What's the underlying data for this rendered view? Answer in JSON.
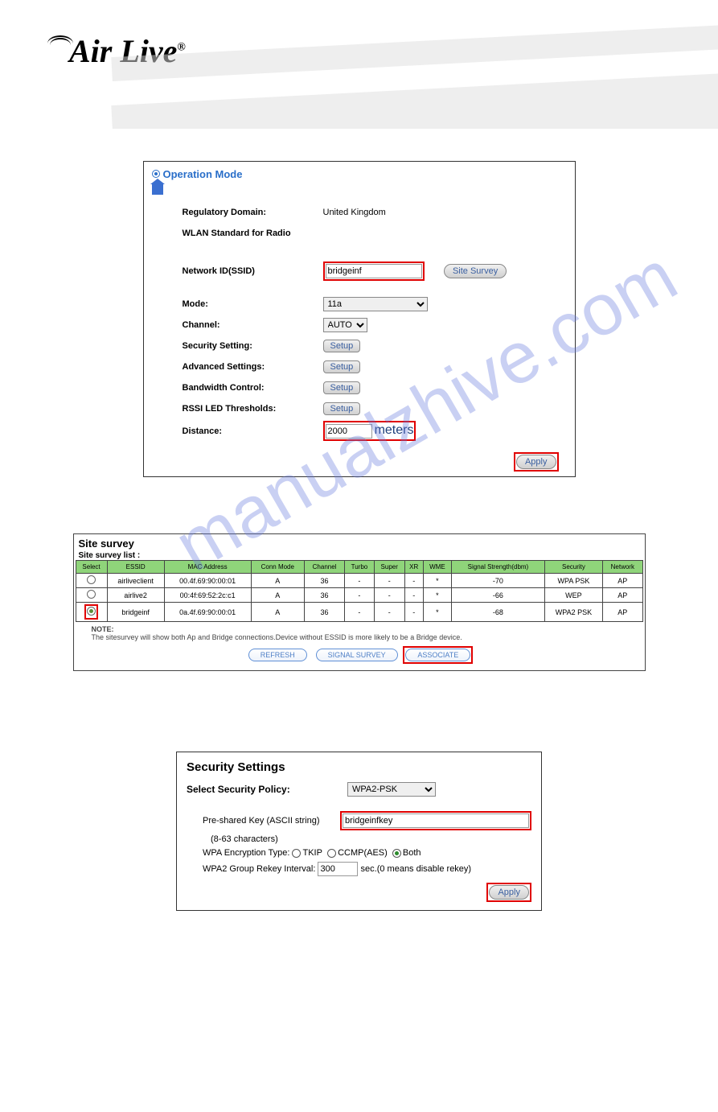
{
  "logo": {
    "text": "Air Live",
    "reg": "®"
  },
  "panel1": {
    "title": "Operation Mode",
    "rows": {
      "reg_domain_lbl": "Regulatory Domain:",
      "reg_domain_val": "United Kingdom",
      "wlan_std_lbl": "WLAN Standard for Radio",
      "ssid_lbl": "Network ID(SSID)",
      "ssid_val": "bridgeinf",
      "site_survey_btn": "Site Survey",
      "mode_lbl": "Mode:",
      "mode_val": "11a",
      "channel_lbl": "Channel:",
      "channel_val": "AUTO",
      "security_lbl": "Security Setting:",
      "adv_lbl": "Advanced Settings:",
      "bw_lbl": "Bandwidth Control:",
      "rssi_lbl": "RSSI LED Thresholds:",
      "setup_btn": "Setup",
      "distance_lbl": "Distance:",
      "distance_val": "2000",
      "meters": "meters",
      "apply_btn": "Apply"
    }
  },
  "panel2": {
    "title": "Site survey",
    "list_lbl": "Site survey list :",
    "headers": [
      "Select",
      "ESSID",
      "MAC Address",
      "Conn Mode",
      "Channel",
      "Turbo",
      "Super",
      "XR",
      "WME",
      "Signal Strength(dbm)",
      "Security",
      "Network"
    ],
    "rows": [
      {
        "sel": false,
        "essid": "airliveclient",
        "mac": "00.4f.69:90:00:01",
        "mode": "A",
        "ch": "36",
        "turbo": "-",
        "super": "-",
        "xr": "-",
        "wme": "*",
        "sig": "-70",
        "sec": "WPA PSK",
        "net": "AP"
      },
      {
        "sel": false,
        "essid": "airlive2",
        "mac": "00:4f:69:52:2c:c1",
        "mode": "A",
        "ch": "36",
        "turbo": "-",
        "super": "-",
        "xr": "-",
        "wme": "*",
        "sig": "-66",
        "sec": "WEP",
        "net": "AP"
      },
      {
        "sel": true,
        "essid": "bridgeinf",
        "mac": "0a.4f.69:90:00:01",
        "mode": "A",
        "ch": "36",
        "turbo": "-",
        "super": "-",
        "xr": "-",
        "wme": "*",
        "sig": "-68",
        "sec": "WPA2 PSK",
        "net": "AP"
      }
    ],
    "note_lbl": "NOTE:",
    "note_txt": "The sitesurvey will show both Ap and Bridge connections.Device without ESSID is more likely to be a Bridge device.",
    "btn_refresh": "REFRESH",
    "btn_signal": "SIGNAL SURVEY",
    "btn_assoc": "ASSOCIATE"
  },
  "panel3": {
    "title": "Security Settings",
    "policy_lbl": "Select Security Policy:",
    "policy_val": "WPA2-PSK",
    "psk_lbl": "Pre-shared Key (ASCII string)",
    "psk_hint": "(8-63 characters)",
    "psk_val": "bridgeinfkey",
    "enc_lbl": "WPA Encryption Type:",
    "enc_tkip": "TKIP",
    "enc_ccmp": "CCMP(AES)",
    "enc_both": "Both",
    "rekey_lbl": "WPA2 Group Rekey Interval:",
    "rekey_val": "300",
    "rekey_unit": "sec.(0 means disable rekey)",
    "apply_btn": "Apply"
  },
  "watermark": "manualzhive.com"
}
